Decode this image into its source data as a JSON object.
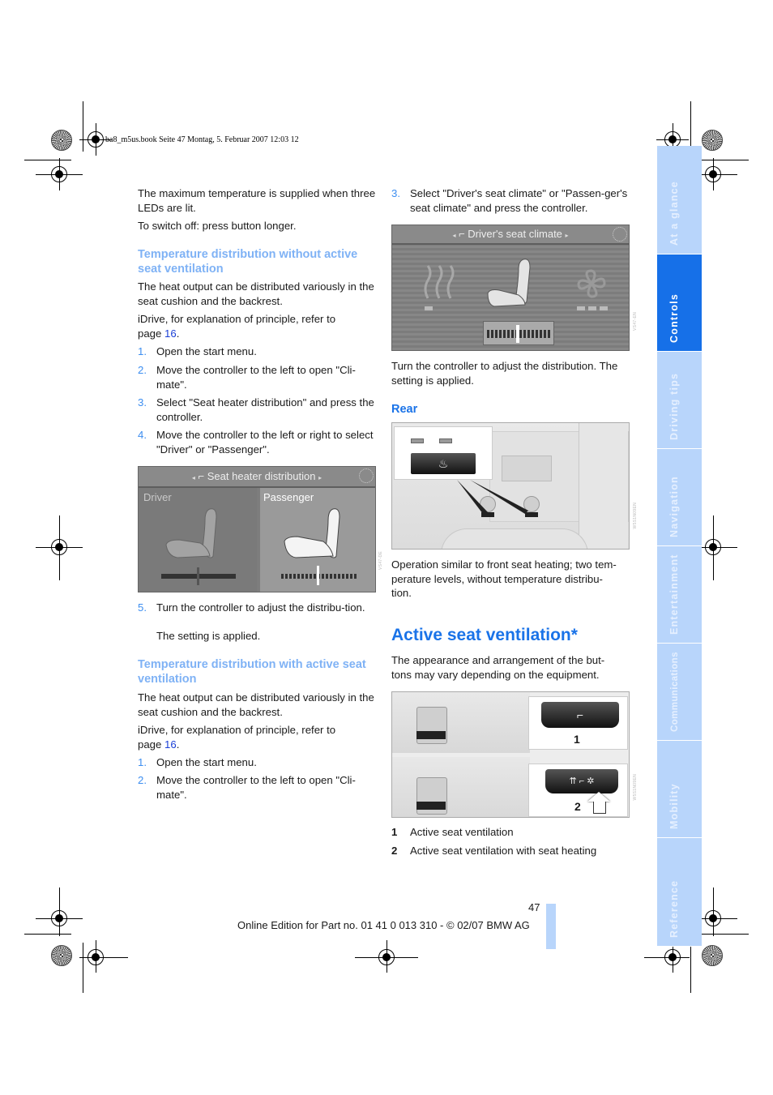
{
  "print_header": "ba8_m5us.book  Seite 47  Montag, 5. Februar 2007  12:03 12",
  "left_column": {
    "intro_paragraphs": [
      "The maximum temperature is supplied when three LEDs are lit.",
      "To switch off: press button longer."
    ],
    "section1": {
      "heading": "Temperature distribution without active seat ventilation",
      "body": "The heat output can be distributed variously in the seat cushion and the backrest.",
      "idrive_ref_prefix": "iDrive, for explanation of principle, refer to page ",
      "idrive_ref_page": "16",
      "idrive_ref_suffix": ".",
      "steps": [
        {
          "num": "1.",
          "text": "Open the start menu."
        },
        {
          "num": "2.",
          "text": "Move the controller to the left to open \"Cli-mate\"."
        },
        {
          "num": "3.",
          "text": "Select \"Seat heater distribution\" and press the controller."
        },
        {
          "num": "4.",
          "text": "Move the controller to the left or right to select \"Driver\" or \"Passenger\"."
        }
      ],
      "figure": {
        "screen_title": "Seat heater distribution",
        "driver_label": "Driver",
        "passenger_label": "Passenger",
        "selected_side": "Passenger"
      },
      "step5": {
        "num": "5.",
        "text": "Turn the controller to adjust the distribu-tion.",
        "note": "The setting is applied."
      }
    },
    "section2": {
      "heading": "Temperature distribution with active seat ventilation",
      "body": "The heat output can be distributed variously in the seat cushion and the backrest.",
      "idrive_ref_prefix": "iDrive, for explanation of principle, refer to page ",
      "idrive_ref_page": "16",
      "idrive_ref_suffix": ".",
      "steps": [
        {
          "num": "1.",
          "text": "Open the start menu."
        },
        {
          "num": "2.",
          "text": "Move the controller to the left to open \"Cli-mate\"."
        }
      ]
    }
  },
  "right_column": {
    "step3": {
      "num": "3.",
      "text": "Select \"Driver's seat climate\" or \"Passen-ger's seat climate\" and press the controller."
    },
    "climate_figure": {
      "screen_title": "Driver's seat climate"
    },
    "after_figure": "Turn the controller to adjust the distribution. The setting is applied.",
    "rear": {
      "heading": "Rear",
      "body": "Operation similar to front seat heating; two tem-perature levels, without temperature distribu-tion."
    },
    "ventilation": {
      "heading": "Active seat ventilation*",
      "body": "The appearance and arrangement of the but-tons may vary depending on the equipment.",
      "figure_callouts": [
        "1",
        "2"
      ],
      "legend": [
        {
          "num": "1",
          "text": "Active seat ventilation"
        },
        {
          "num": "2",
          "text": "Active seat ventilation with seat heating"
        }
      ]
    }
  },
  "side_tabs": [
    {
      "label": "At a glance",
      "active": false
    },
    {
      "label": "Controls",
      "active": true
    },
    {
      "label": "Driving tips",
      "active": false
    },
    {
      "label": "Navigation",
      "active": false
    },
    {
      "label": "Entertainment",
      "active": false
    },
    {
      "label": "Communications",
      "active": false
    },
    {
      "label": "Mobility",
      "active": false
    },
    {
      "label": "Reference",
      "active": false
    }
  ],
  "footer": {
    "page_number": "47",
    "edition": "Online Edition for Part no. 01 41 0 013 310 - © 02/07 BMW AG"
  },
  "colors": {
    "accent_blue": "#1a73e8",
    "light_heading": "#7fb2f5",
    "tab_inactive": "#b8d5fb",
    "tab_active": "#1670e8",
    "link": "#1a3fd6"
  }
}
